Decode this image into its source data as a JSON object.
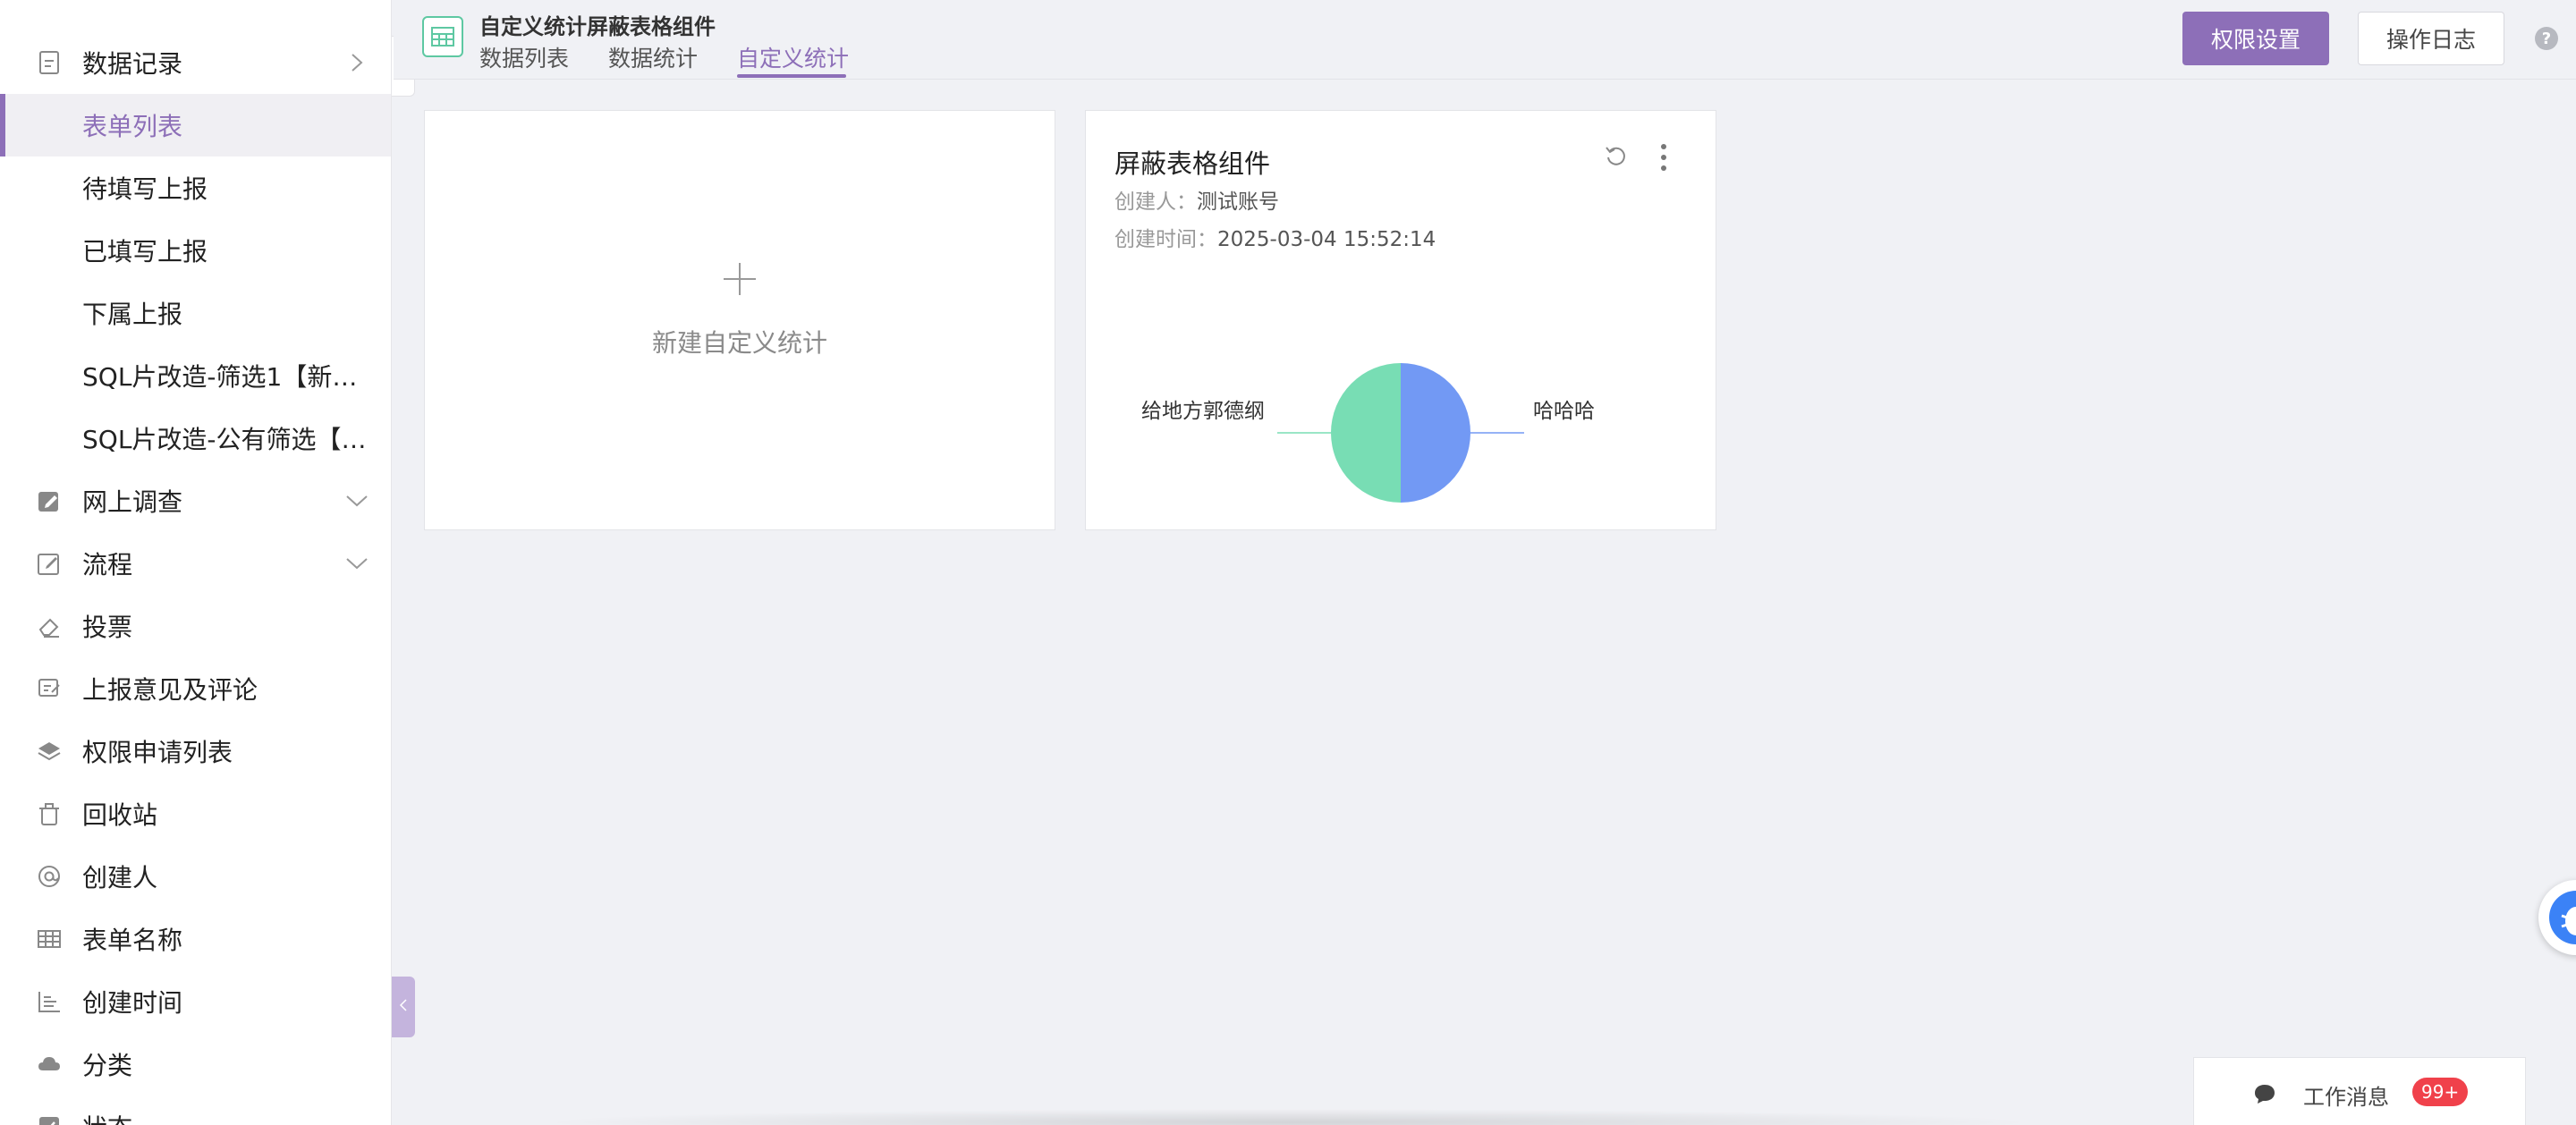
{
  "colors": {
    "accent": "#8d6fb8",
    "pie_blue": "#7299f4",
    "pie_green": "#78ddb4",
    "badge_red": "#f0414b",
    "form_icon": "#5ec8a2"
  },
  "sidebar": {
    "items": [
      {
        "label": "数据记录",
        "icon": "file-doc-icon",
        "expand": "chevron-right-icon"
      },
      {
        "label": "表单列表",
        "active": true
      },
      {
        "label": "待填写上报"
      },
      {
        "label": "已填写上报"
      },
      {
        "label": "下属上报"
      },
      {
        "label": "SQL片改造-筛选1【新…"
      },
      {
        "label": "SQL片改造-公有筛选【…"
      },
      {
        "label": "网上调查",
        "icon": "edit-icon",
        "expand": "chevron-down-icon"
      },
      {
        "label": "流程",
        "icon": "edit-doc-icon",
        "expand": "chevron-down-icon"
      },
      {
        "label": "投票",
        "icon": "eraser-icon"
      },
      {
        "label": "上报意见及评论",
        "icon": "comment-edit-icon"
      },
      {
        "label": "权限申请列表",
        "icon": "layers-icon"
      },
      {
        "label": "回收站",
        "icon": "trash-icon"
      },
      {
        "label": "创建人",
        "icon": "at-icon"
      },
      {
        "label": "表单名称",
        "icon": "table-icon"
      },
      {
        "label": "创建时间",
        "icon": "bar-chart-icon"
      },
      {
        "label": "分类",
        "icon": "cloud-icon"
      },
      {
        "label": "状态",
        "icon": "check-square-icon"
      }
    ]
  },
  "header": {
    "title": "自定义统计屏蔽表格组件",
    "tabs": [
      {
        "label": "数据列表"
      },
      {
        "label": "数据统计"
      },
      {
        "label": "自定义统计",
        "active": true
      }
    ],
    "permission_button": "权限设置",
    "log_button": "操作日志",
    "help": "?"
  },
  "new_card": {
    "label": "新建自定义统计"
  },
  "stat_card": {
    "title": "屏蔽表格组件",
    "creator_label": "创建人：",
    "creator": "测试账号",
    "created_label": "创建时间：",
    "created_at": "2025-03-04 15:52:14"
  },
  "chart_data": {
    "type": "pie",
    "title": "",
    "labels": [
      "哈哈哈",
      "给地方郭德纲"
    ],
    "values": [
      50,
      50
    ],
    "colors": [
      "#7299f4",
      "#78ddb4"
    ]
  },
  "work_messages": {
    "label": "工作消息",
    "badge": "99+"
  }
}
